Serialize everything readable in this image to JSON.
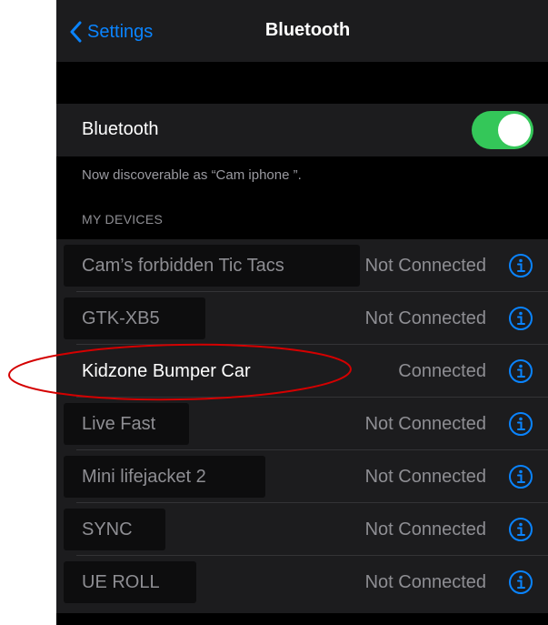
{
  "nav": {
    "back_label": "Settings",
    "title": "Bluetooth"
  },
  "bluetooth": {
    "label": "Bluetooth",
    "enabled": true,
    "discoverable_text": "Now discoverable as “Cam iphone ”."
  },
  "devices": {
    "header": "MY DEVICES",
    "items": [
      {
        "name": "Cam’s forbidden Tic Tacs",
        "status": "Not Connected"
      },
      {
        "name": "GTK-XB5",
        "status": "Not Connected"
      },
      {
        "name": "Kidzone Bumper Car",
        "status": "Connected"
      },
      {
        "name": "Live Fast",
        "status": "Not Connected"
      },
      {
        "name": "Mini lifejacket 2",
        "status": "Not Connected"
      },
      {
        "name": "SYNC",
        "status": "Not Connected"
      },
      {
        "name": "UE ROLL",
        "status": "Not Connected"
      }
    ]
  },
  "colors": {
    "accent": "#0a84ff",
    "switch_on": "#34c759",
    "annotation": "#d40000"
  }
}
